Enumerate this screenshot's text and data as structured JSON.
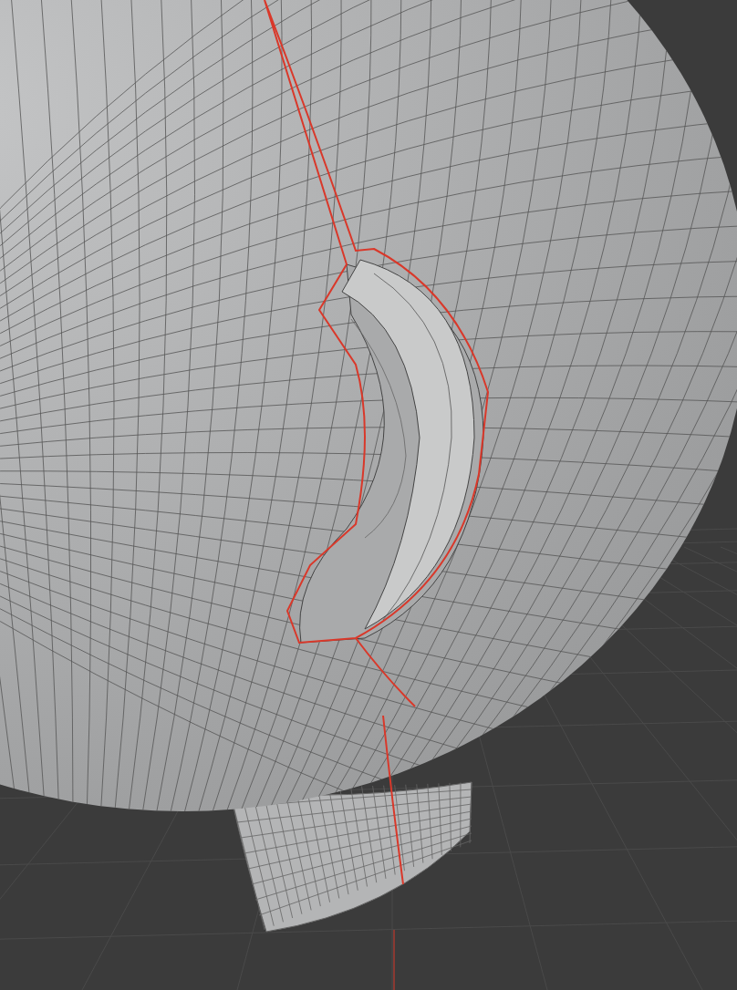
{
  "viewport": {
    "kind": "mesh-editor",
    "seams_visible": true
  }
}
